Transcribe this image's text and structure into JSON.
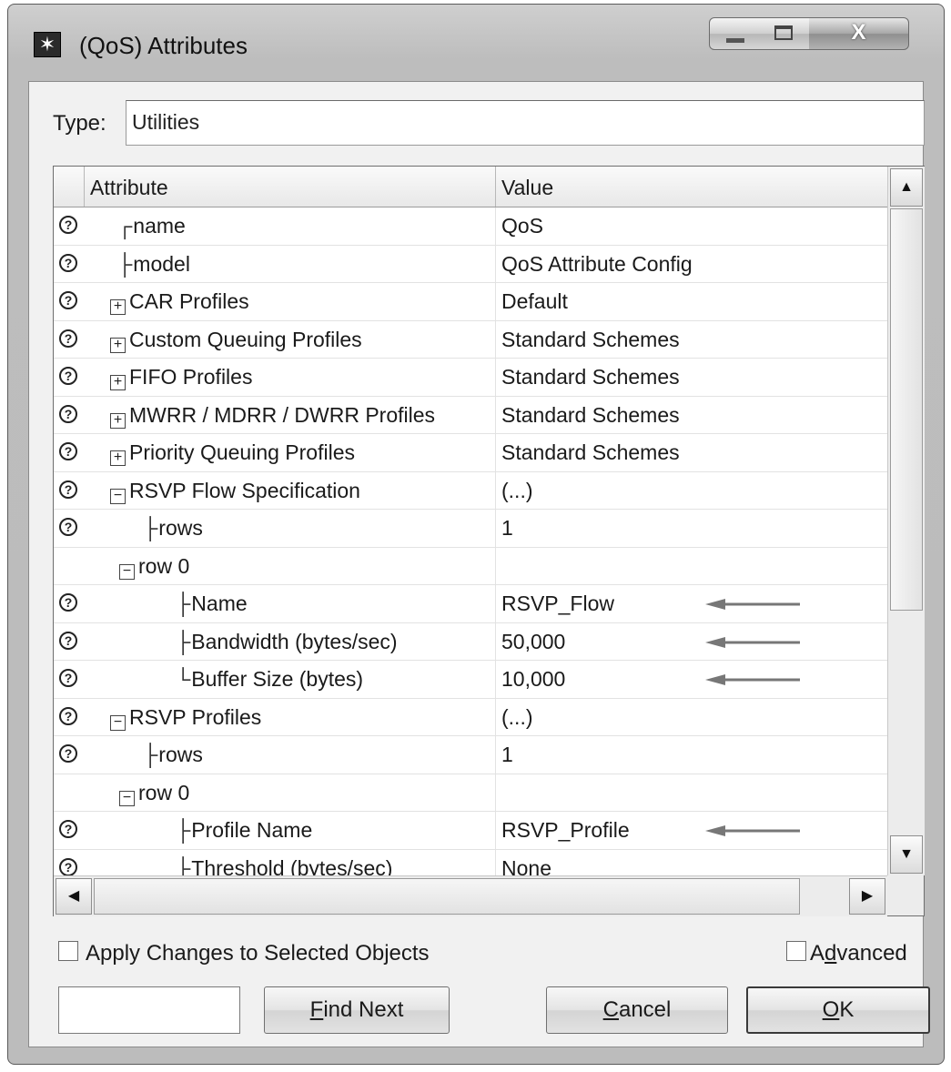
{
  "window": {
    "title": "(QoS) Attributes",
    "close_label": "X"
  },
  "type_field": {
    "label": "Type:",
    "value": "Utilities"
  },
  "grid": {
    "columns": [
      "Attribute",
      "Value"
    ],
    "rows": [
      {
        "help": true,
        "indent": 0,
        "prefix": "┌",
        "expander": null,
        "label": "name",
        "value": "QoS",
        "arrow": false
      },
      {
        "help": true,
        "indent": 0,
        "prefix": "├",
        "expander": null,
        "label": "model",
        "value": "QoS Attribute Config",
        "arrow": false
      },
      {
        "help": true,
        "indent": 0,
        "prefix": "",
        "expander": "+",
        "label": "CAR Profiles",
        "value": "Default",
        "arrow": false
      },
      {
        "help": true,
        "indent": 0,
        "prefix": "",
        "expander": "+",
        "label": "Custom Queuing Profiles",
        "value": "Standard Schemes",
        "arrow": false
      },
      {
        "help": true,
        "indent": 0,
        "prefix": "",
        "expander": "+",
        "label": "FIFO Profiles",
        "value": "Standard Schemes",
        "arrow": false
      },
      {
        "help": true,
        "indent": 0,
        "prefix": "",
        "expander": "+",
        "label": "MWRR / MDRR / DWRR Profiles",
        "value": "Standard Schemes",
        "arrow": false
      },
      {
        "help": true,
        "indent": 0,
        "prefix": "",
        "expander": "+",
        "label": "Priority Queuing Profiles",
        "value": "Standard Schemes",
        "arrow": false
      },
      {
        "help": true,
        "indent": 0,
        "prefix": "",
        "expander": "−",
        "label": "RSVP Flow Specification",
        "value": "(...)",
        "arrow": false
      },
      {
        "help": true,
        "indent": 1,
        "prefix": "├",
        "expander": null,
        "label": "rows",
        "value": "1",
        "arrow": false
      },
      {
        "help": false,
        "indent": 1,
        "prefix": "",
        "expander": "−",
        "label": "row 0",
        "value": "",
        "arrow": false
      },
      {
        "help": true,
        "indent": 2,
        "prefix": "├",
        "expander": null,
        "label": "Name",
        "value": "RSVP_Flow",
        "arrow": true
      },
      {
        "help": true,
        "indent": 2,
        "prefix": "├",
        "expander": null,
        "label": "Bandwidth (bytes/sec)",
        "value": "50,000",
        "arrow": true
      },
      {
        "help": true,
        "indent": 2,
        "prefix": "└",
        "expander": null,
        "label": "Buffer Size (bytes)",
        "value": "10,000",
        "arrow": true
      },
      {
        "help": true,
        "indent": 0,
        "prefix": "",
        "expander": "−",
        "label": "RSVP Profiles",
        "value": "(...)",
        "arrow": false
      },
      {
        "help": true,
        "indent": 1,
        "prefix": "├",
        "expander": null,
        "label": "rows",
        "value": "1",
        "arrow": false
      },
      {
        "help": false,
        "indent": 1,
        "prefix": "",
        "expander": "−",
        "label": "row 0",
        "value": "",
        "arrow": false
      },
      {
        "help": true,
        "indent": 2,
        "prefix": "├",
        "expander": null,
        "label": "Profile Name",
        "value": "RSVP_Profile",
        "arrow": true
      },
      {
        "help": true,
        "indent": 2,
        "prefix": "├",
        "expander": null,
        "label": "Threshold (bytes/sec)",
        "value": "None",
        "arrow": false
      }
    ]
  },
  "options": {
    "apply_changes_label": "Apply Changes to Selected Objects",
    "apply_changes_checked": false,
    "advanced_prefix": "A",
    "advanced_hotkey": "d",
    "advanced_suffix": "vanced",
    "advanced_checked": false
  },
  "buttons": {
    "find_value": "",
    "find_next_hotkey": "F",
    "find_next_rest": "ind Next",
    "cancel_hotkey": "C",
    "cancel_rest": "ancel",
    "ok_hotkey": "O",
    "ok_rest": "K"
  },
  "icons": {
    "help": "question-circle-icon",
    "arrow": "left-arrow-icon",
    "expand": "plus-box-icon",
    "collapse": "minus-box-icon"
  },
  "colors": {
    "titlebar": "#c4c4c4",
    "client_bg": "#f1f1f1",
    "grid_bg": "#ffffff",
    "arrow": "#777777"
  }
}
